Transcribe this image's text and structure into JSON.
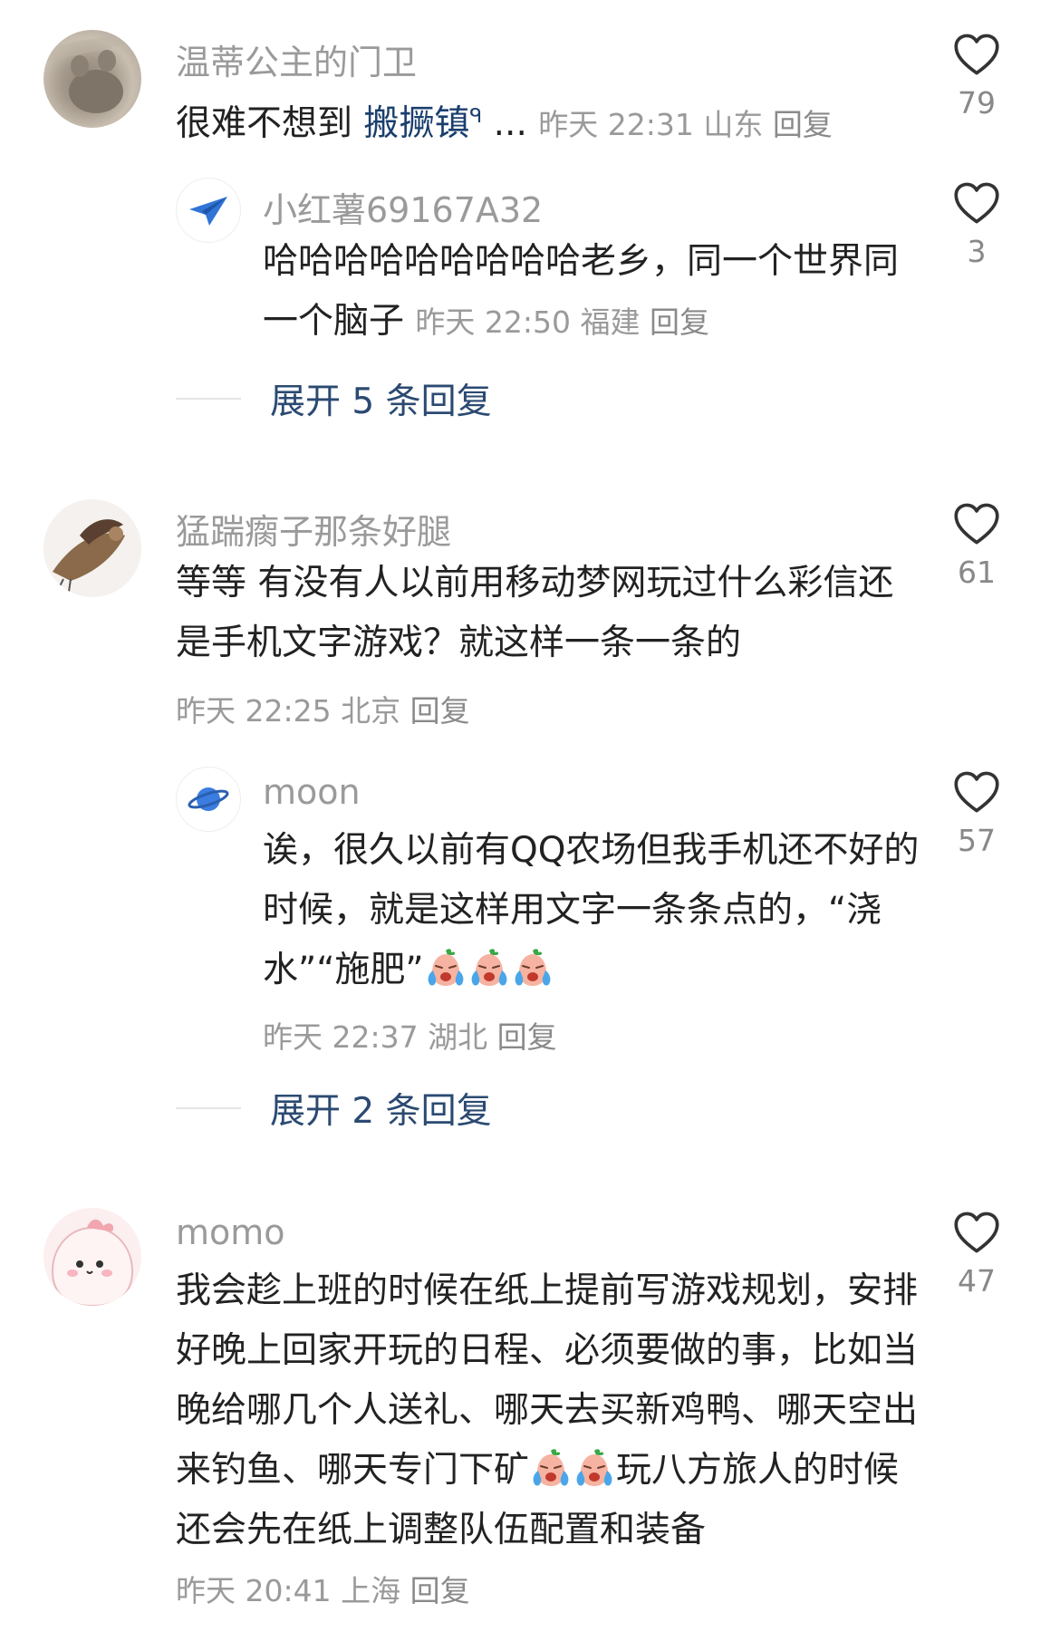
{
  "comments": [
    {
      "username": "温蒂公主的门卫",
      "text_pre": "很难不想到 ",
      "link": "搬撅镇",
      "link_mark": "ᑫ",
      "ellipsis": " ... ",
      "time": "昨天 22:31",
      "location": "山东",
      "reply": "回复",
      "likes": "79",
      "avatar_icon": "cat-paw-avatar",
      "replies": [
        {
          "username": "小红薯69167A32",
          "text": "哈哈哈哈哈哈哈哈哈老乡，同一个世界同一个脑子",
          "time": "昨天 22:50",
          "location": "福建",
          "reply": "回复",
          "likes": "3",
          "avatar_icon": "paper-plane-avatar"
        }
      ],
      "expand": "展开 5 条回复"
    },
    {
      "username": "猛踹瘸子那条好腿",
      "text": "等等 有没有人以前用移动梦网玩过什么彩信还是手机文字游戏？就这样一条一条的",
      "time": "昨天 22:25",
      "location": "北京",
      "reply": "回复",
      "likes": "61",
      "avatar_icon": "sparrow-avatar",
      "replies": [
        {
          "username": "moon",
          "text": "诶，很久以前有QQ农场但我手机还不好的时候，就是这样用文字一条条点的，“浇水”“施肥”",
          "time": "昨天 22:37",
          "location": "湖北",
          "reply": "回复",
          "likes": "57",
          "avatar_icon": "planet-avatar",
          "emoji": "crying-face-emoji"
        }
      ],
      "expand": "展开 2 条回复"
    },
    {
      "username": "momo",
      "text_1": "我会趁上班的时候在纸上提前写游戏规划，安排好晚上回家开玩的日程、必须要做的事，比如当晚给哪几个人送礼、哪天去买新鸡鸭、哪天空出来钓鱼、哪天专门下矿",
      "text_2": "玩八方旅人的时候还会先在纸上调整队伍配置和装备",
      "time": "昨天 20:41",
      "location": "上海",
      "reply": "回复",
      "likes": "47",
      "avatar_icon": "pink-creature-avatar",
      "emoji": "crying-face-emoji"
    }
  ],
  "colors": {
    "username": "#9a9a9a",
    "text": "#222222",
    "meta": "#9a9a9a",
    "expand": "#2b4a72",
    "link": "#1a3f6e"
  }
}
